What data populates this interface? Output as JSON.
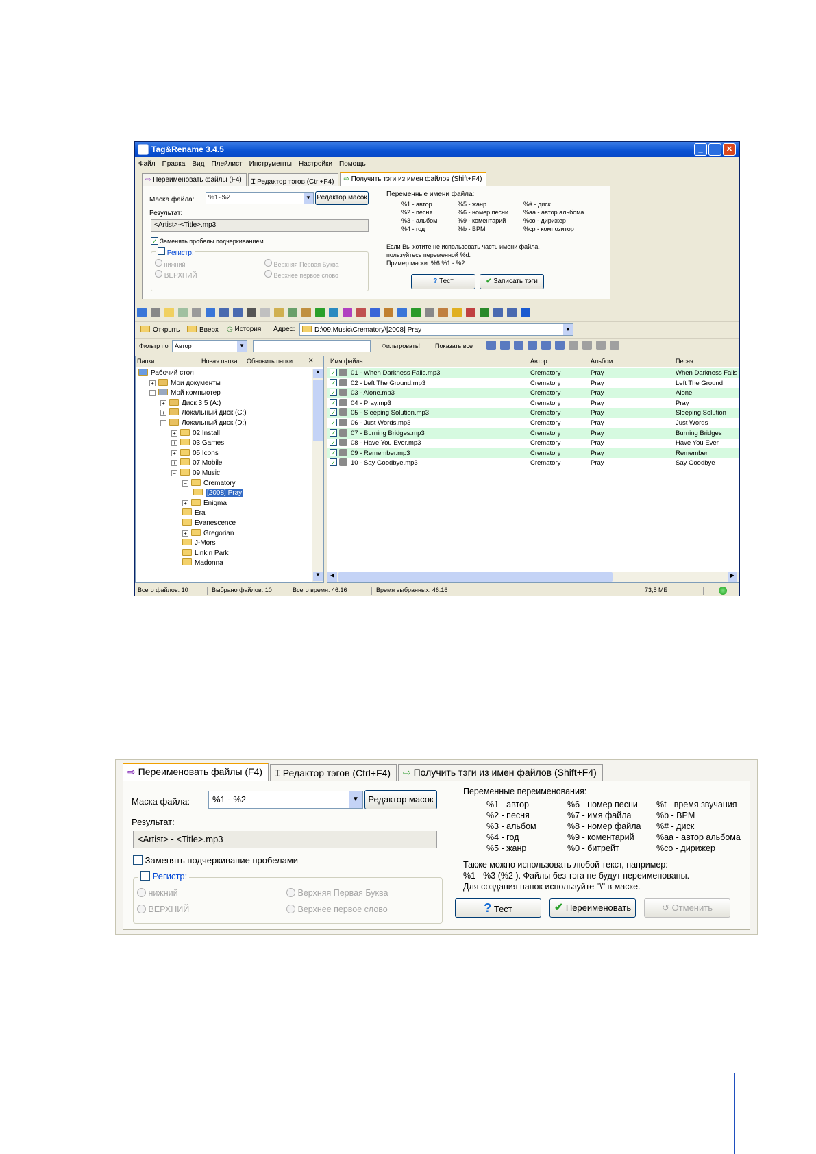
{
  "window": {
    "title": "Tag&Rename 3.4.5",
    "menu": [
      "Файл",
      "Правка",
      "Вид",
      "Плейлист",
      "Инструменты",
      "Настройки",
      "Помощь"
    ],
    "tabs": [
      {
        "label": "Переименовать файлы (F4)"
      },
      {
        "label": "Редактор тэгов (Ctrl+F4)"
      },
      {
        "label": "Получить тэги из имен файлов (Shift+F4)"
      }
    ],
    "mask_label": "Маска файла:",
    "mask_value": "%1-%2",
    "mask_editor_button": "Редактор масок",
    "result_label": "Результат:",
    "result_value": "<Artist>-<Title>.mp3",
    "replace_spaces_label": "Заменять пробелы подчеркиванием",
    "register_label": "Регистр:",
    "register_options": [
      "нижний",
      "ВЕРХНИЙ",
      "Верхняя Первая Буква",
      "Верхнее первое слово"
    ],
    "vars_title": "Переменные имени файла:",
    "vars_col1": [
      "%1 - автор",
      "%2 - песня",
      "%3 - альбом",
      "%4 - год"
    ],
    "vars_col2": [
      "%5 - жанр",
      "%6 - номер песни",
      "%9 - коментарий",
      "%b - BPM"
    ],
    "vars_col3": [
      "%# - диск",
      "%aa - автор альбома",
      "%co - дирижер",
      "%cp - композитор"
    ],
    "hint_lines": [
      "Если Вы хотите не использовать часть имени файла,",
      "пользуйтесь переменной %d.",
      "Пример маски: %6 %1 - %2"
    ],
    "test_button": "Тест",
    "write_tags_button": "Записать тэги",
    "nav": {
      "open": "Открыть",
      "up": "Вверх",
      "history": "История",
      "address_label": "Адрес:",
      "address_value": "D:\\09.Music\\Crematory\\[2008] Pray"
    },
    "filter": {
      "label": "Фильтр по",
      "field": "Автор",
      "apply": "Фильтровать!",
      "show_all": "Показать все"
    },
    "tree_header": {
      "folders": "Папки",
      "new_folder": "Новая папка",
      "refresh": "Обновить папки",
      "close": "✕"
    },
    "tree": [
      {
        "label": "Рабочий стол",
        "level": 0,
        "pm": ""
      },
      {
        "label": "Мои документы",
        "level": 1,
        "pm": "+"
      },
      {
        "label": "Мой компьютер",
        "level": 1,
        "pm": "−"
      },
      {
        "label": "Диск 3,5 (A:)",
        "level": 2,
        "pm": "+"
      },
      {
        "label": "Локальный диск (C:)",
        "level": 2,
        "pm": "+"
      },
      {
        "label": "Локальный диск (D:)",
        "level": 2,
        "pm": "−"
      },
      {
        "label": "02.Install",
        "level": 3,
        "pm": "+"
      },
      {
        "label": "03.Games",
        "level": 3,
        "pm": "+"
      },
      {
        "label": "05.Icons",
        "level": 3,
        "pm": "+"
      },
      {
        "label": "07.Mobile",
        "level": 3,
        "pm": "+"
      },
      {
        "label": "09.Music",
        "level": 3,
        "pm": "−"
      },
      {
        "label": "Crematory",
        "level": 4,
        "pm": "−"
      },
      {
        "label": "[2008] Pray",
        "level": 5,
        "pm": "",
        "selected": true
      },
      {
        "label": "Enigma",
        "level": 4,
        "pm": "+"
      },
      {
        "label": "Era",
        "level": 4,
        "pm": ""
      },
      {
        "label": "Evanescence",
        "level": 4,
        "pm": ""
      },
      {
        "label": "Gregorian",
        "level": 4,
        "pm": "+"
      },
      {
        "label": "J-Mors",
        "level": 4,
        "pm": ""
      },
      {
        "label": "Linkin Park",
        "level": 4,
        "pm": ""
      },
      {
        "label": "Madonna",
        "level": 4,
        "pm": ""
      }
    ],
    "columns": [
      "Имя файла",
      "Автор",
      "Альбом",
      "Песня"
    ],
    "files": [
      {
        "name": "01 - When Darkness Falls.mp3",
        "artist": "Crematory",
        "album": "Pray",
        "song": "When Darkness Falls"
      },
      {
        "name": "02 - Left The Ground.mp3",
        "artist": "Crematory",
        "album": "Pray",
        "song": "Left The Ground"
      },
      {
        "name": "03 - Alone.mp3",
        "artist": "Crematory",
        "album": "Pray",
        "song": "Alone"
      },
      {
        "name": "04 - Pray.mp3",
        "artist": "Crematory",
        "album": "Pray",
        "song": "Pray"
      },
      {
        "name": "05 - Sleeping Solution.mp3",
        "artist": "Crematory",
        "album": "Pray",
        "song": "Sleeping Solution"
      },
      {
        "name": "06 - Just Words.mp3",
        "artist": "Crematory",
        "album": "Pray",
        "song": "Just Words"
      },
      {
        "name": "07 - Burning Bridges.mp3",
        "artist": "Crematory",
        "album": "Pray",
        "song": "Burning Bridges"
      },
      {
        "name": "08 - Have You Ever.mp3",
        "artist": "Crematory",
        "album": "Pray",
        "song": "Have You Ever"
      },
      {
        "name": "09 - Remember.mp3",
        "artist": "Crematory",
        "album": "Pray",
        "song": "Remember"
      },
      {
        "name": "10 - Say Goodbye.mp3",
        "artist": "Crematory",
        "album": "Pray",
        "song": "Say Goodbye"
      }
    ],
    "status": {
      "total_files": "Всего файлов: 10",
      "selected_files": "Выбрано файлов: 10",
      "total_time": "Всего время: 46:16",
      "selected_time": "Время выбранных: 46:16",
      "size": "73,5 МБ"
    }
  },
  "panel2": {
    "tabs": [
      {
        "label": "Переименовать файлы (F4)"
      },
      {
        "label": "Редактор тэгов (Ctrl+F4)"
      },
      {
        "label": "Получить тэги из имен файлов (Shift+F4)"
      }
    ],
    "mask_label": "Маска файла:",
    "mask_value": "%1 - %2",
    "mask_editor_button": "Редактор масок",
    "result_label": "Результат:",
    "result_value": "<Artist> - <Title>.mp3",
    "replace_label": "Заменять подчеркивание пробелами",
    "register_label": "Регистр:",
    "register_options": [
      "нижний",
      "ВЕРХНИЙ",
      "Верхняя Первая Буква",
      "Верхнее первое слово"
    ],
    "vars_title": "Переменные переименования:",
    "vars_col1": [
      "%1 - автор",
      "%2 - песня",
      "%3 - альбом",
      "%4 - год",
      "%5 - жанр"
    ],
    "vars_col2": [
      "%6 - номер песни",
      "%7 - имя файла",
      "%8 - номер файла",
      "%9 - коментарий",
      "%0 - битрейт"
    ],
    "vars_col3": [
      "%t - время звучания",
      "%b - BPM",
      "%# - диск",
      "%aa - автор альбома",
      "%co - дирижер"
    ],
    "hint_lines": [
      "Также можно использовать любой текст, например:",
      "%1 - %3 (%2 ). Файлы без тэга не будут переименованы.",
      "Для создания папок используйте \"\\\" в маске."
    ],
    "test_button": "Тест",
    "rename_button": "Переименовать",
    "cancel_button": "Отменить"
  }
}
